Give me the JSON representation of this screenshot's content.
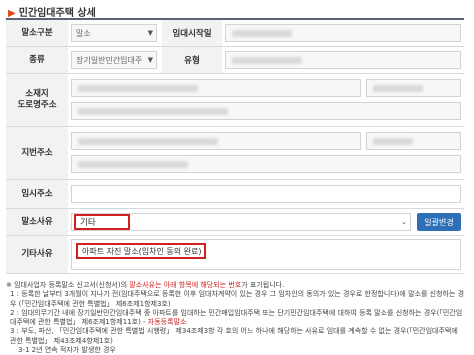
{
  "page_title": "민간임대주택 상세",
  "rows": {
    "cancel_type": {
      "label": "말소구분",
      "value": "말소"
    },
    "rental_start": {
      "label": "임대시작일"
    },
    "kind": {
      "label": "종류",
      "value": "장기일반민간임대주"
    },
    "house_type": {
      "label": "유형"
    },
    "road_address": {
      "label": "소재지\n도로명주소"
    },
    "lot_address": {
      "label": "지번주소"
    },
    "temp_address": {
      "label": "임시주소"
    },
    "reason": {
      "label": "말소사유",
      "value": "기타",
      "button": "일괄변경"
    },
    "other_reason": {
      "label": "기타사유",
      "value": "아파트 자진 말소(임차인 동의 완료)"
    }
  },
  "notes": [
    {
      "text": "※ 임대사업자 등록말소 신고서(신청서)의 ",
      "red": "말소사유는 아래 항목에 해당되는 번호",
      "tail": "가 표기됩니다."
    },
    {
      "text": "1 : 등록한 날부터 3개월이 지나기 전(임대주택으로 등록한 이후 임대차계약이 있는 경우 그 임차인의 동의가 있는 경우로 한정합니다)에 말소를 신청하는 경우 (「민간임대주택에 관한 특별법」 제6조제1항제3호)"
    },
    {
      "text": "2 : 임대의무기간 내에 장기일반민간임대주택 중 아파트를 임대하는 민간매입임대주택 또는 단기민간임대주택에 대하여 등록 말소를 신청하는 경우(「민간임대주택에 관한 특별법」 제6조제1항제11호) - ",
      "red": "자동등록말소"
    },
    {
      "text": "3 : 부도, 파산, 「민간임대주택에 관한 특별법 시행령」 제34조제3항 각 호의 어느 하나에 해당하는 사유로 임대를 계속할 수 없는 경우(「민간임대주택에 관한 특별법」 제43조제4항제1호)"
    },
    {
      "text": "3-1 2년 연속 적자가 발생한 경우"
    }
  ]
}
